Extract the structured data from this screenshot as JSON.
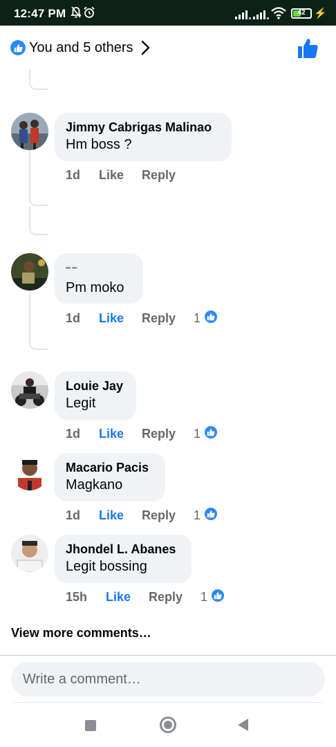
{
  "status_bar": {
    "time": "12:47 PM",
    "battery": "42",
    "icons": [
      "mute-bell-icon",
      "alarm-icon",
      "signal-icon",
      "signal-icon",
      "wifi-icon",
      "battery-icon",
      "charging-icon"
    ]
  },
  "reactions": {
    "label": "You and 5 others",
    "icon": "like-icon"
  },
  "comments": [
    {
      "name": "Jimmy Cabrigas Malinao",
      "text": "Hm boss ?",
      "time": "1d",
      "like": "Like",
      "reply": "Reply",
      "liked": false,
      "likes": ""
    },
    {
      "name": "˜˜ ˜˜",
      "text": "Pm moko",
      "time": "1d",
      "like": "Like",
      "reply": "Reply",
      "liked": true,
      "likes": "1"
    },
    {
      "name": "Louie Jay",
      "text": "Legit",
      "time": "1d",
      "like": "Like",
      "reply": "Reply",
      "liked": true,
      "likes": "1"
    },
    {
      "name": "Macario Pacis",
      "text": "Magkano",
      "time": "1d",
      "like": "Like",
      "reply": "Reply",
      "liked": true,
      "likes": "1"
    },
    {
      "name": "Jhondel L. Abanes",
      "text": "Legit bossing",
      "time": "15h",
      "like": "Like",
      "reply": "Reply",
      "liked": true,
      "likes": "1"
    }
  ],
  "view_more": "View more comments…",
  "composer": {
    "placeholder": "Write a comment…"
  },
  "colors": {
    "accent": "#1877f2",
    "like_badge": "#2d88ff",
    "bubble": "#f0f2f5",
    "meta": "#65676b",
    "status_bg": "#0d2217"
  }
}
